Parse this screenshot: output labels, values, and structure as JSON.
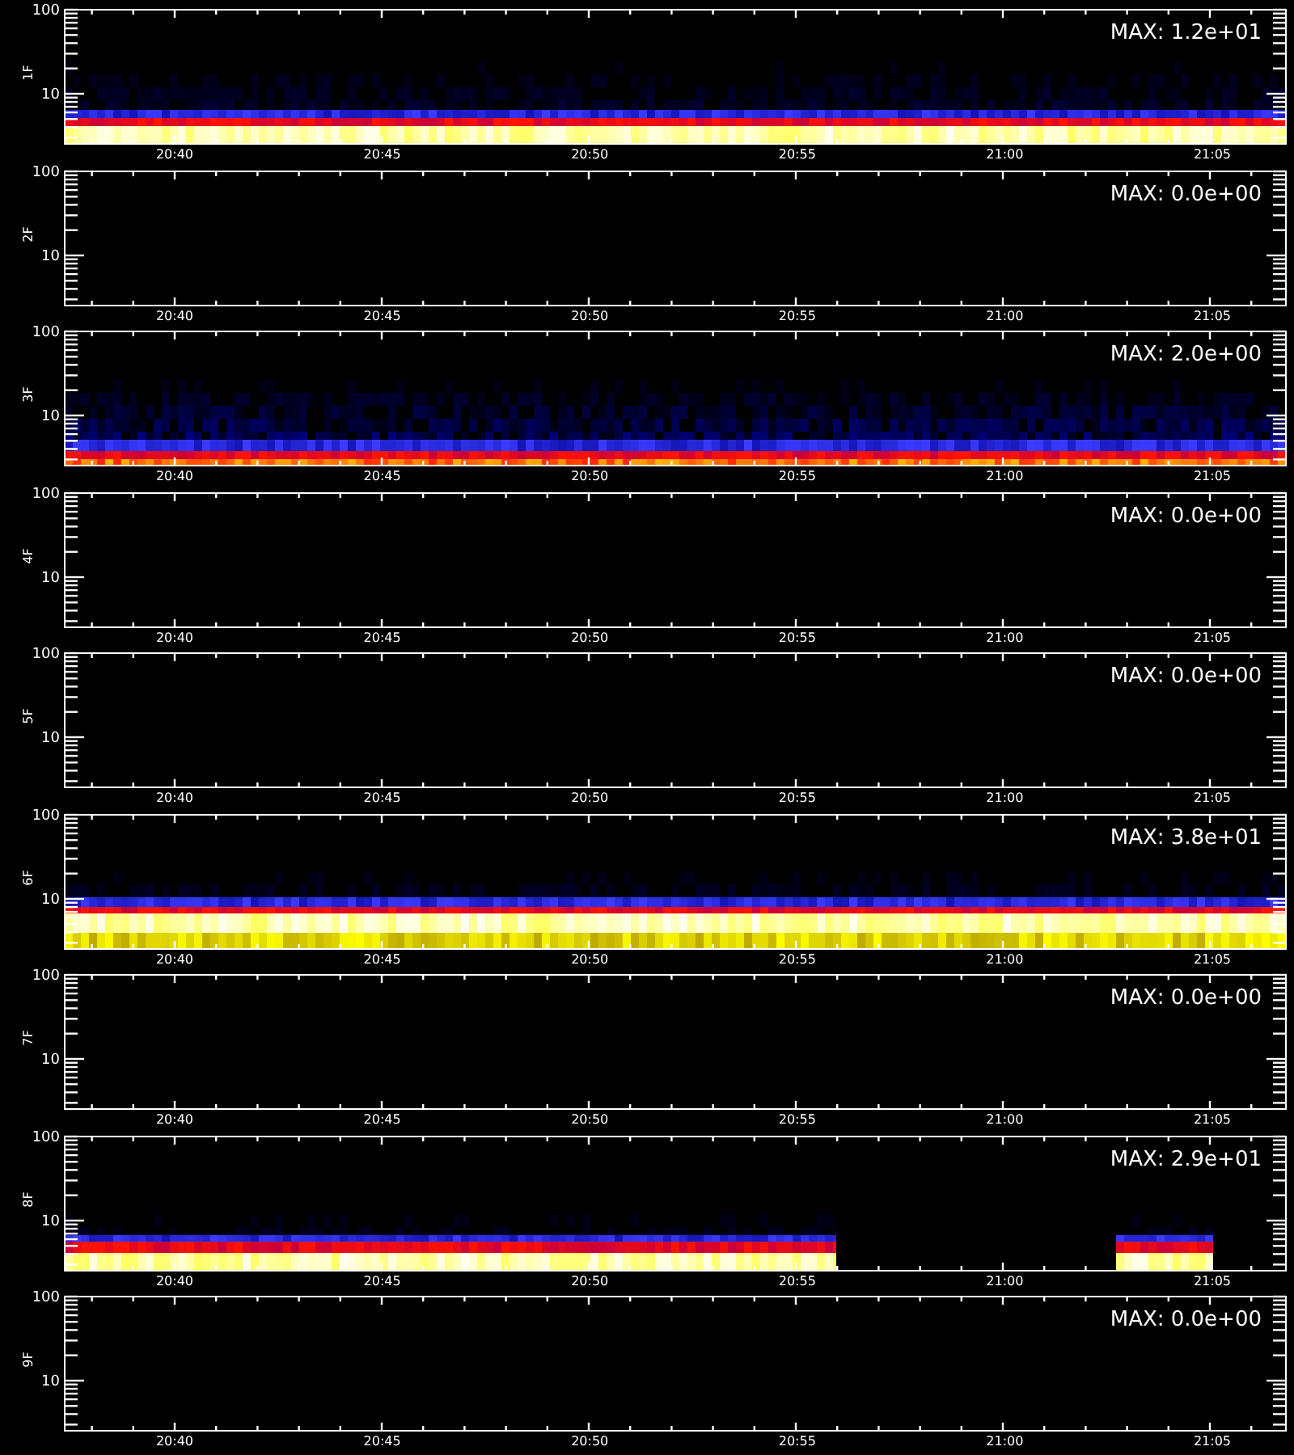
{
  "panels": [
    {
      "label": "1F",
      "max": "MAX: 1.2e+01",
      "kind": "steady",
      "y_ticks": [
        "100",
        "10"
      ],
      "x_ticks": [
        "20:40",
        "20:45",
        "20:50",
        "20:55",
        "21:00",
        "21:05"
      ]
    },
    {
      "label": "2F",
      "max": "MAX: 0.0e+00",
      "kind": "none",
      "y_ticks": [
        "100",
        "10"
      ],
      "x_ticks": [
        "20:40",
        "20:45",
        "20:50",
        "20:55",
        "21:00",
        "21:05"
      ]
    },
    {
      "label": "3F",
      "max": "MAX: 2.0e+00",
      "kind": "noisy",
      "y_ticks": [
        "100",
        "10"
      ],
      "x_ticks": [
        "20:40",
        "20:45",
        "20:50",
        "20:55",
        "21:00",
        "21:05"
      ]
    },
    {
      "label": "4F",
      "max": "MAX: 0.0e+00",
      "kind": "none",
      "y_ticks": [
        "100",
        "10"
      ],
      "x_ticks": [
        "20:40",
        "20:45",
        "20:50",
        "20:55",
        "21:00",
        "21:05"
      ]
    },
    {
      "label": "5F",
      "max": "MAX: 0.0e+00",
      "kind": "none",
      "y_ticks": [
        "100",
        "10"
      ],
      "x_ticks": [
        "20:40",
        "20:45",
        "20:50",
        "20:55",
        "21:00",
        "21:05"
      ]
    },
    {
      "label": "6F",
      "max": "MAX: 3.8e+01",
      "kind": "strong",
      "y_ticks": [
        "100",
        "10"
      ],
      "x_ticks": [
        "20:40",
        "20:45",
        "20:50",
        "20:55",
        "21:00",
        "21:05"
      ]
    },
    {
      "label": "7F",
      "max": "MAX: 0.0e+00",
      "kind": "none",
      "y_ticks": [
        "100",
        "10"
      ],
      "x_ticks": [
        "20:40",
        "20:45",
        "20:50",
        "20:55",
        "21:00",
        "21:05"
      ]
    },
    {
      "label": "8F",
      "max": "MAX: 2.9e+01",
      "kind": "gapped",
      "y_ticks": [
        "100",
        "10"
      ],
      "x_ticks": [
        "20:40",
        "20:45",
        "20:50",
        "20:55",
        "21:00",
        "21:05"
      ]
    },
    {
      "label": "9F",
      "max": "MAX: 0.0e+00",
      "kind": "none",
      "y_ticks": [
        "100",
        "10"
      ],
      "x_ticks": [
        "20:40",
        "20:45",
        "20:50",
        "20:55",
        "21:00",
        "21:05"
      ]
    }
  ]
}
